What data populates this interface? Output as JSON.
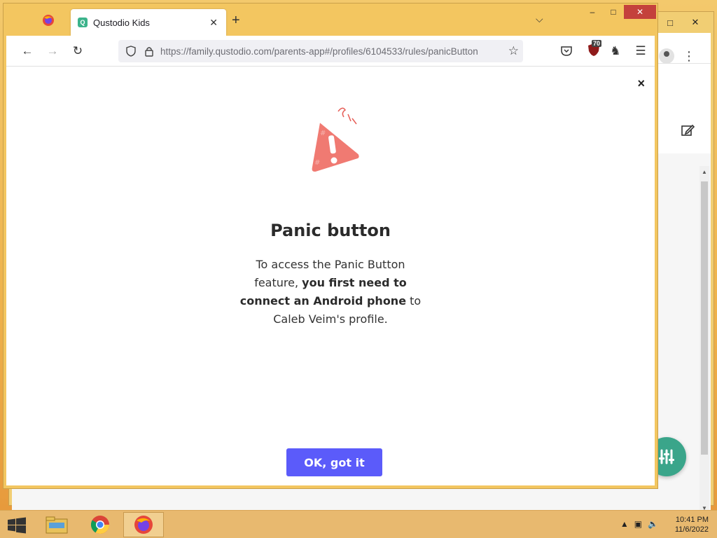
{
  "browser": {
    "tab_title": "Qustodio Kids",
    "tab_favicon_letter": "Q",
    "url": "https://family.qustodio.com/parents-app#/profiles/6104533/rules/panicButton",
    "url_domain": "qustodio.com",
    "extension_badge": "70",
    "window_controls": {
      "minimize": "–",
      "maximize": "□",
      "close": "✕"
    }
  },
  "background_window": {
    "controls": {
      "maximize": "□",
      "close": "✕"
    }
  },
  "modal": {
    "title": "Panic button",
    "description_part1": "To access the Panic Button feature, ",
    "description_bold": "you first need to connect an Android phone",
    "description_part2": " to Caleb Veim's profile.",
    "ok_button": "OK, got it",
    "close_label": "×"
  },
  "taskbar": {
    "time": "10:41 PM",
    "date": "11/6/2022"
  },
  "colors": {
    "accent_button": "#5b5bfa",
    "illustration": "#f07a72",
    "fab": "#3aa58a"
  }
}
